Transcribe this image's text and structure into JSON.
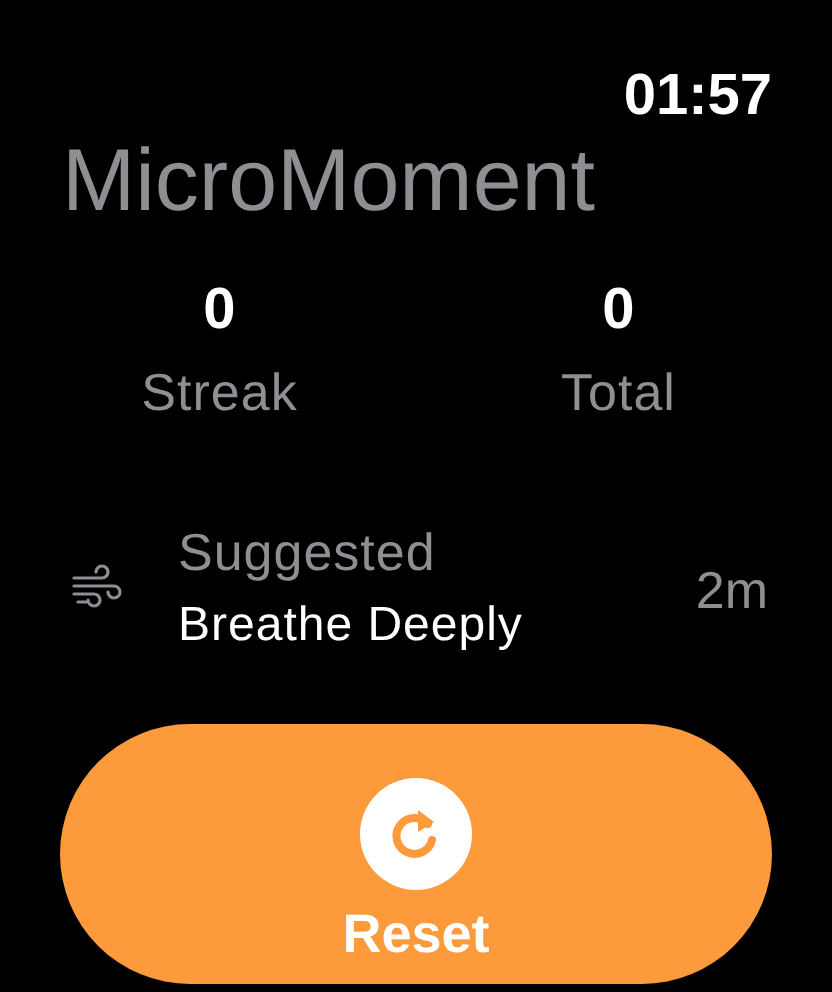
{
  "status_bar": {
    "time": "01:57"
  },
  "title": "MicroMoment",
  "stats": [
    {
      "value": "0",
      "label": "Streak"
    },
    {
      "value": "0",
      "label": "Total"
    }
  ],
  "suggestion": {
    "heading": "Suggested",
    "name": "Breathe Deeply",
    "duration": "2m"
  },
  "button": {
    "label": "Reset"
  }
}
